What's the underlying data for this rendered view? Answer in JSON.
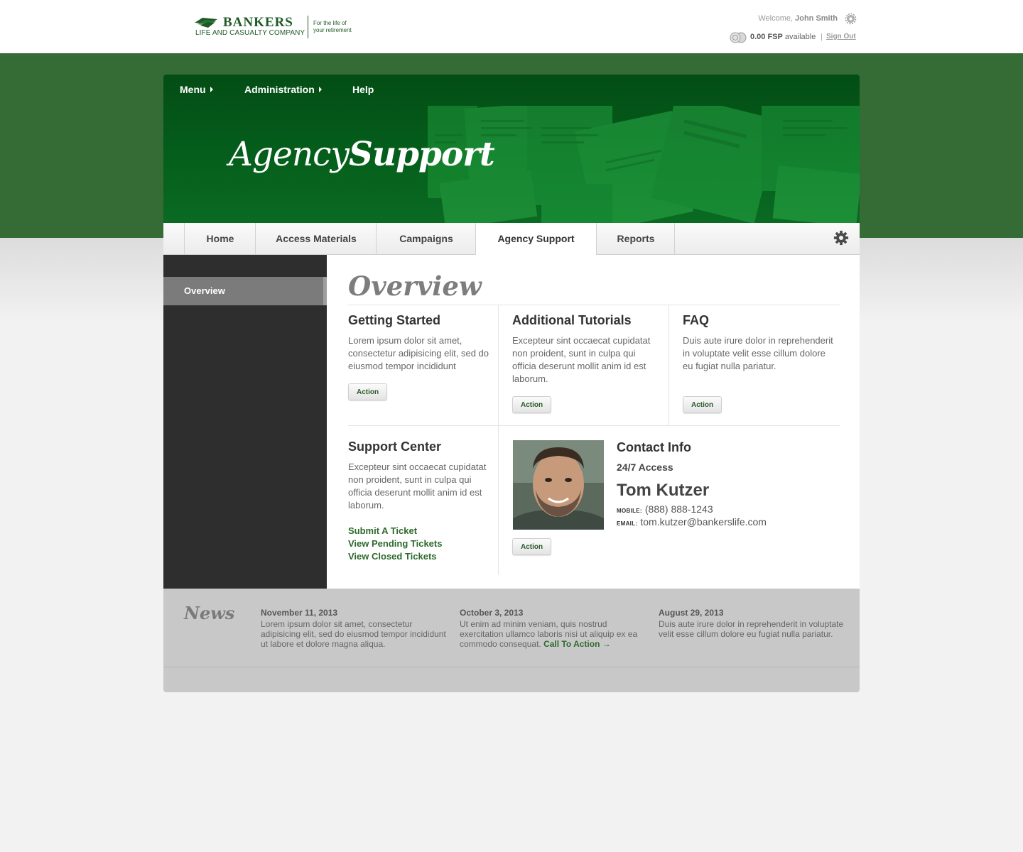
{
  "header": {
    "logo": {
      "name": "BANKERS",
      "sub": "LIFE AND CASUALTY COMPANY",
      "tagline_1": "For the life of",
      "tagline_2": "your retirement"
    },
    "welcome_prefix": "Welcome,",
    "user_name": "John Smith",
    "fsp_amount": "0.00 FSP",
    "fsp_suffix": "available",
    "separator": "|",
    "sign_out": "Sign Out"
  },
  "topnav": [
    {
      "label": "Menu",
      "has_arrow": true
    },
    {
      "label": "Administration",
      "has_arrow": true
    },
    {
      "label": "Help",
      "has_arrow": false
    }
  ],
  "hero": {
    "title_part1": "Agency",
    "title_part2": "Support"
  },
  "tabs": [
    {
      "label": "Home",
      "active": false
    },
    {
      "label": "Access Materials",
      "active": false
    },
    {
      "label": "Campaigns",
      "active": false
    },
    {
      "label": "Agency Support",
      "active": true
    },
    {
      "label": "Reports",
      "active": false
    }
  ],
  "sidebar": {
    "items": [
      {
        "label": "Overview",
        "active": true
      }
    ]
  },
  "main": {
    "title": "Overview",
    "cards": [
      {
        "title": "Getting Started",
        "body": "Lorem ipsum dolor sit amet, consectetur adipisicing elit, sed do eiusmod tempor incididunt",
        "action": "Action"
      },
      {
        "title": "Additional Tutorials",
        "body": "Excepteur sint occaecat cupidatat non proident, sunt in culpa qui officia deserunt mollit anim id est laborum.",
        "action": "Action"
      },
      {
        "title": "FAQ",
        "body": "Duis aute irure dolor in reprehenderit in voluptate velit esse cillum dolore eu fugiat nulla pariatur.",
        "action": "Action"
      }
    ],
    "support_center": {
      "title": "Support Center",
      "body": "Excepteur sint occaecat cupidatat non proident, sunt in culpa qui officia deserunt mollit anim id est laborum.",
      "links": [
        "Submit A Ticket",
        "View Pending Tickets",
        "View Closed Tickets"
      ]
    },
    "contact": {
      "title": "Contact Info",
      "access": "24/7 Access",
      "name": "Tom Kutzer",
      "mobile_label": "MOBILE:",
      "mobile": "(888) 888-1243",
      "email_label": "EMAIL:",
      "email": "tom.kutzer@bankerslife.com",
      "action": "Action"
    }
  },
  "news": {
    "title": "News",
    "items": [
      {
        "date": "November 11, 2013",
        "body": "Lorem ipsum dolor sit amet, consectetur adipisicing elit, sed do eiusmod tempor incididunt ut labore et dolore magna aliqua.",
        "cta": ""
      },
      {
        "date": "October 3, 2013",
        "body": "Ut enim ad minim veniam, quis nostrud exercitation ullamco laboris nisi ut aliquip ex ea commodo consequat.",
        "cta": "Call To Action →"
      },
      {
        "date": "August 29, 2013",
        "body": "Duis aute irure dolor in reprehenderit in voluptate velit esse cillum dolore eu fugiat nulla pariatur.",
        "cta": ""
      }
    ]
  },
  "icons": {
    "settings_small": "gear-icon",
    "settings_tab": "gear-icon",
    "fsp": "coin-icon",
    "nav_arrow": "triangle-right-icon"
  },
  "colors": {
    "brand_green": "#1f5a26",
    "band_green": "#356b35",
    "hero_green": "#05601c",
    "link_green": "#2d6a2d",
    "sidebar_dark": "#2e2e2e"
  }
}
